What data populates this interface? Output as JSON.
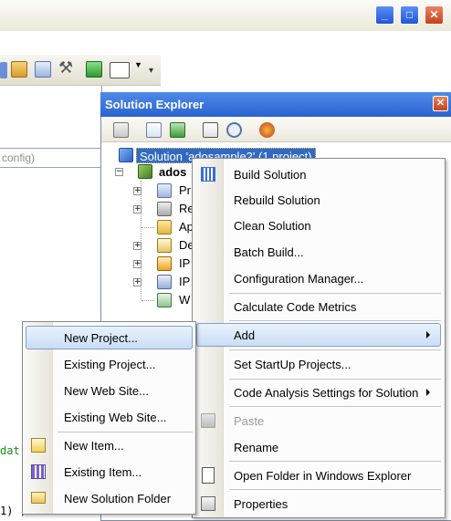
{
  "window": {
    "minimize": "_",
    "maximize": "□",
    "close": "✕"
  },
  "editor": {
    "config_fragment": "config)",
    "code_line_1": "dat",
    "code_line_2": "1) ;"
  },
  "solution_explorer": {
    "title": "Solution Explorer",
    "close": "✕",
    "solution_label": "Solution 'adosample2' (1 project)",
    "project_label": "ados",
    "tree_items": [
      {
        "label": "Pr"
      },
      {
        "label": "Re"
      },
      {
        "label": "Ap"
      },
      {
        "label": "De"
      },
      {
        "label": "IP"
      },
      {
        "label": "IP"
      },
      {
        "label": "W"
      }
    ]
  },
  "context_menu": {
    "items": [
      {
        "label": "Build Solution"
      },
      {
        "label": "Rebuild Solution"
      },
      {
        "label": "Clean Solution"
      },
      {
        "label": "Batch Build..."
      },
      {
        "label": "Configuration Manager..."
      },
      {
        "label": "Calculate Code Metrics"
      },
      {
        "label": "Add"
      },
      {
        "label": "Set StartUp Projects..."
      },
      {
        "label": "Code Analysis Settings for Solution"
      },
      {
        "label": "Paste"
      },
      {
        "label": "Rename"
      },
      {
        "label": "Open Folder in Windows Explorer"
      },
      {
        "label": "Properties"
      }
    ]
  },
  "add_submenu": {
    "items": [
      {
        "label": "New Project..."
      },
      {
        "label": "Existing Project..."
      },
      {
        "label": "New Web Site..."
      },
      {
        "label": "Existing Web Site..."
      },
      {
        "label": "New Item..."
      },
      {
        "label": "Existing Item..."
      },
      {
        "label": "New Solution Folder"
      }
    ]
  }
}
